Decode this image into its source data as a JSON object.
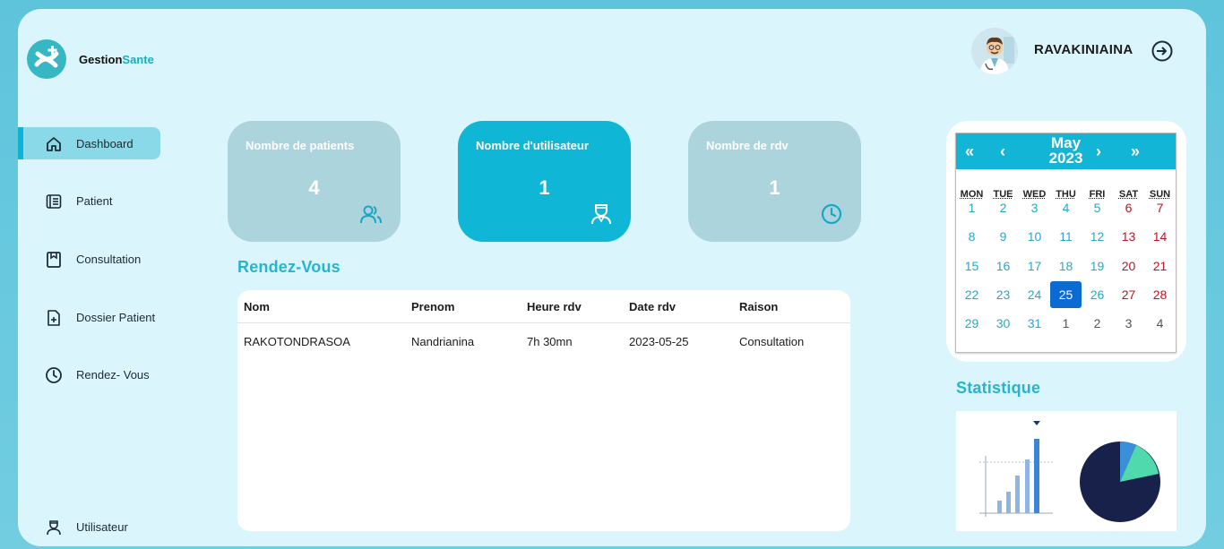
{
  "brand": {
    "name_part1": "Gestion",
    "name_part2": "Sante"
  },
  "sidebar": {
    "items": [
      {
        "label": "Dashboard",
        "icon": "home-icon",
        "active": true
      },
      {
        "label": "Patient",
        "icon": "patient-list-icon"
      },
      {
        "label": "Consultation",
        "icon": "consultation-icon"
      },
      {
        "label": "Dossier Patient",
        "icon": "file-plus-icon"
      },
      {
        "label": "Rendez- Vous",
        "icon": "clock-icon"
      },
      {
        "label": "Utilisateur",
        "icon": "user-nurse-icon"
      }
    ]
  },
  "header": {
    "username": "RAVAKINIAINA",
    "avatar": "doctor-avatar",
    "logout_icon": "logout-icon"
  },
  "cards": [
    {
      "title": "Nombre de patients",
      "value": "4",
      "icon": "users-icon"
    },
    {
      "title": "Nombre d'utilisateur",
      "value": "1",
      "icon": "user-nurse-icon",
      "active": true
    },
    {
      "title": "Nombre de rdv",
      "value": "1",
      "icon": "clock-icon"
    }
  ],
  "appointments": {
    "title": "Rendez-Vous",
    "columns": [
      "Nom",
      "Prenom",
      "Heure rdv",
      "Date rdv",
      "Raison"
    ],
    "rows": [
      [
        "RAKOTONDRASOA",
        "Nandrianina",
        "7h 30mn",
        "2023-05-25",
        "Consultation"
      ]
    ]
  },
  "calendar": {
    "month": "May",
    "year": "2023",
    "nav": {
      "prev_year": "«",
      "prev_month": "‹",
      "next_month": "›",
      "next_year": "»"
    },
    "weekdays": [
      "MON",
      "TUE",
      "WED",
      "THU",
      "FRI",
      "SAT",
      "SUN"
    ],
    "weeks": [
      [
        "1",
        "2",
        "3",
        "4",
        "5",
        "6",
        "7"
      ],
      [
        "8",
        "9",
        "10",
        "11",
        "12",
        "13",
        "14"
      ],
      [
        "15",
        "16",
        "17",
        "18",
        "19",
        "20",
        "21"
      ],
      [
        "22",
        "23",
        "24",
        "25",
        "26",
        "27",
        "28"
      ],
      [
        "29",
        "30",
        "31",
        "1",
        "2",
        "3",
        "4"
      ]
    ],
    "selected_day": "25",
    "colors": {
      "header": "#12b5d6",
      "weekend": "#c1121f",
      "weekday": "#2aa6c6",
      "selected": "#0c6bd0"
    }
  },
  "statistics": {
    "title": "Statistique",
    "illustration": "bar-and-pie-chart-illustration"
  },
  "colors": {
    "accent": "#0fb6d6",
    "card_inactive": "#acd4dd",
    "panel_bg": "#dbf5fd"
  }
}
